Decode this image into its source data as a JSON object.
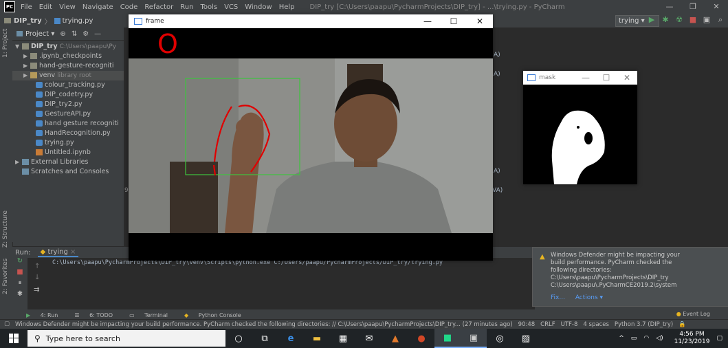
{
  "ide": {
    "logo": "PC",
    "menu": [
      "File",
      "Edit",
      "View",
      "Navigate",
      "Code",
      "Refactor",
      "Run",
      "Tools",
      "VCS",
      "Window",
      "Help"
    ],
    "window_title": "DIP_try [C:\\Users\\paapu\\PycharmProjects\\DIP_try] - ...\\trying.py - PyCharm",
    "window_controls": [
      "—",
      "❐",
      "✕"
    ]
  },
  "navbar": {
    "project": "DIP_try",
    "file": "trying.py",
    "run_config": "trying ▾"
  },
  "side_labels": {
    "project": "1: Project",
    "structure": "Z: Structure",
    "favorites": "2: Favorites"
  },
  "project_panel": {
    "title": "Project ▾",
    "root_name": "DIP_try",
    "root_path": "C:\\Users\\paapu\\Py",
    "items": [
      {
        "label": ".ipynb_checkpoints",
        "type": "folder",
        "arrow": "▶"
      },
      {
        "label": "hand-gesture-recogniti",
        "type": "folder",
        "arrow": "▶"
      },
      {
        "label": "venv",
        "note": "library root",
        "type": "folder",
        "arrow": "▶"
      },
      {
        "label": "colour_tracking.py",
        "type": "py"
      },
      {
        "label": "DIP_codetry.py",
        "type": "py"
      },
      {
        "label": "DIP_try2.py",
        "type": "py"
      },
      {
        "label": "GestureAPI.py",
        "type": "py"
      },
      {
        "label": "hand gesture recogniti",
        "type": "py"
      },
      {
        "label": "HandRecognition.py",
        "type": "py"
      },
      {
        "label": "trying.py",
        "type": "py"
      },
      {
        "label": "Untitled.ipynb",
        "type": "nb"
      },
      {
        "label": "External Libraries",
        "type": "lib",
        "arrow": "▶"
      },
      {
        "label": "Scratches and Consoles",
        "type": "lib"
      }
    ]
  },
  "editor": {
    "gutter_number": "9",
    "code_fragments": [
      "A)",
      "A)",
      "A)",
      "VA)"
    ]
  },
  "run_panel": {
    "label": "Run:",
    "tab": "trying",
    "command": "C:\\Users\\paapu\\PycharmProjects\\DIP_try\\venv\\Scripts\\python.exe C:/Users/paapu/PycharmProjects/DIP_try/trying.py"
  },
  "tool_tabs": [
    "4: Run",
    "6: TODO",
    "Terminal",
    "Python Console"
  ],
  "event_log": "Event Log",
  "status": {
    "message": "Windows Defender might be impacting your build performance. PyCharm checked the following directories: // C:\\Users\\paapu\\PycharmProjects\\DIP_try... (27 minutes ago)",
    "position": "90:48",
    "line_sep": "CRLF",
    "encoding": "UTF-8",
    "indent": "4 spaces",
    "interpreter": "Python 3.7 (DIP_try)"
  },
  "notification": {
    "lines": [
      "Windows Defender might be impacting your",
      "build performance. PyCharm checked the",
      "following directories:",
      "C:\\Users\\paapu\\PycharmProjects\\DIP_try",
      "C:\\Users\\paapu\\.PyCharmCE2019.2\\system"
    ],
    "fix": "Fix...",
    "actions": "Actions ▾"
  },
  "frame_window": {
    "title": "frame",
    "overlay_text": "O"
  },
  "mask_window": {
    "title": "mask"
  },
  "taskbar": {
    "search_placeholder": "Type here to search",
    "time": "4:56 PM",
    "date": "11/23/2019"
  },
  "colors": {
    "ide_bg": "#3c3f41",
    "editor_bg": "#2b2b2b",
    "overlay_red": "#e00000",
    "roi_green": "#3ec43e",
    "taskbar": "#1f2326"
  }
}
